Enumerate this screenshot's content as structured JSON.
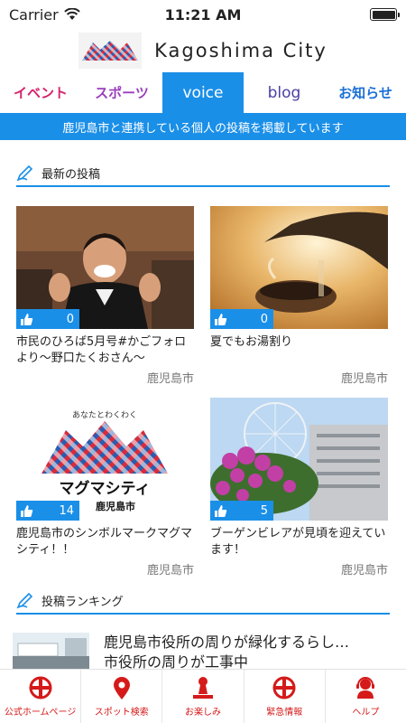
{
  "status": {
    "carrier": "Carrier",
    "time": "11:21 AM",
    "battery_level": 1.0
  },
  "header": {
    "title": "Kagoshima City",
    "logo_icon": "magma-city-logo-icon"
  },
  "tabs": [
    {
      "label": "イベント"
    },
    {
      "label": "スポーツ"
    },
    {
      "label": "voice",
      "selected": true
    },
    {
      "label": "blog"
    },
    {
      "label": "お知らせ"
    }
  ],
  "banner": "鹿児島市と連携している個人の投稿を掲載しています",
  "sections": {
    "latest": "最新の投稿",
    "ranking": "投稿ランキング"
  },
  "cards": [
    {
      "likes": "0",
      "title": "市民のひろば5月号#かごフォロより～野口たくおさん～",
      "author": "鹿児島市"
    },
    {
      "likes": "0",
      "title": "夏でもお湯割り",
      "author": "鹿児島市"
    },
    {
      "likes": "14",
      "title": "鹿児島市のシンボルマークマグマシティ！！",
      "author": "鹿児島市",
      "image_text_top": "あなたとわくわく",
      "image_text_main": "マグマシティ",
      "image_text_sub": "鹿児島市"
    },
    {
      "likes": "5",
      "title": "ブーゲンビレアが見頃を迎えています！",
      "author": "鹿児島市"
    }
  ],
  "ranking": [
    {
      "title": "鹿児島市役所の周りが緑化するらし…",
      "subtitle": "市役所の周りが工事中"
    }
  ],
  "bottom_nav": [
    {
      "label": "公式ホームページ",
      "icon": "city-emblem-icon"
    },
    {
      "label": "スポット検索",
      "icon": "map-pin-icon"
    },
    {
      "label": "お楽しみ",
      "icon": "stamp-icon"
    },
    {
      "label": "緊急情報",
      "icon": "city-emblem-icon"
    },
    {
      "label": "ヘルプ",
      "icon": "support-agent-icon"
    }
  ],
  "colors": {
    "accent": "#1a8fe8",
    "nav_red": "#d51a1a"
  }
}
